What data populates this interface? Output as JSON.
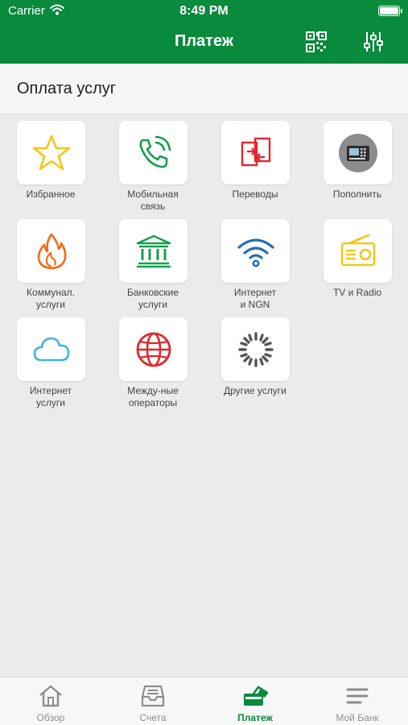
{
  "status_bar": {
    "carrier": "Carrier",
    "time": "8:49 PM"
  },
  "nav": {
    "title": "Платеж",
    "qr_icon": "qr-code-icon",
    "settings_icon": "sliders-icon"
  },
  "section": {
    "title": "Оплата услуг"
  },
  "tiles": [
    {
      "label": "Избранное",
      "icon": "star-icon",
      "color": "#f5c518"
    },
    {
      "label": "Мобильная\nсвязь",
      "icon": "phone-call-icon",
      "color": "#14a14a"
    },
    {
      "label": "Переводы",
      "icon": "transfer-icon",
      "color": "#e0282e"
    },
    {
      "label": "Пополнить",
      "icon": "terminal-icon",
      "color": "#8c8c8c"
    },
    {
      "label": "Коммунал.\nуслуги",
      "icon": "fire-icon",
      "color": "#f26a1b"
    },
    {
      "label": "Банковские\nуслуги",
      "icon": "bank-icon",
      "color": "#14a14a"
    },
    {
      "label": "Интернет\nи NGN",
      "icon": "wifi-icon",
      "color": "#1f6fb5"
    },
    {
      "label": "TV и Radio",
      "icon": "radio-icon",
      "color": "#f5c518"
    },
    {
      "label": "Интернет\nуслуги",
      "icon": "cloud-icon",
      "color": "#3fb3e8"
    },
    {
      "label": "Междy-ные\nоператоры",
      "icon": "globe-icon",
      "color": "#e0282e"
    },
    {
      "label": "Другие услуги",
      "icon": "spinner-icon",
      "color": "#555555"
    }
  ],
  "tabs": [
    {
      "label": "Обзор",
      "icon": "home-icon",
      "active": false
    },
    {
      "label": "Счета",
      "icon": "inbox-icon",
      "active": false
    },
    {
      "label": "Платеж",
      "icon": "payment-icon",
      "active": true
    },
    {
      "label": "Мой Банк",
      "icon": "menu-icon",
      "active": false
    }
  ],
  "colors": {
    "brand": "#0a8a3c",
    "background": "#ebebeb",
    "tab_inactive": "#8e8e8e"
  }
}
